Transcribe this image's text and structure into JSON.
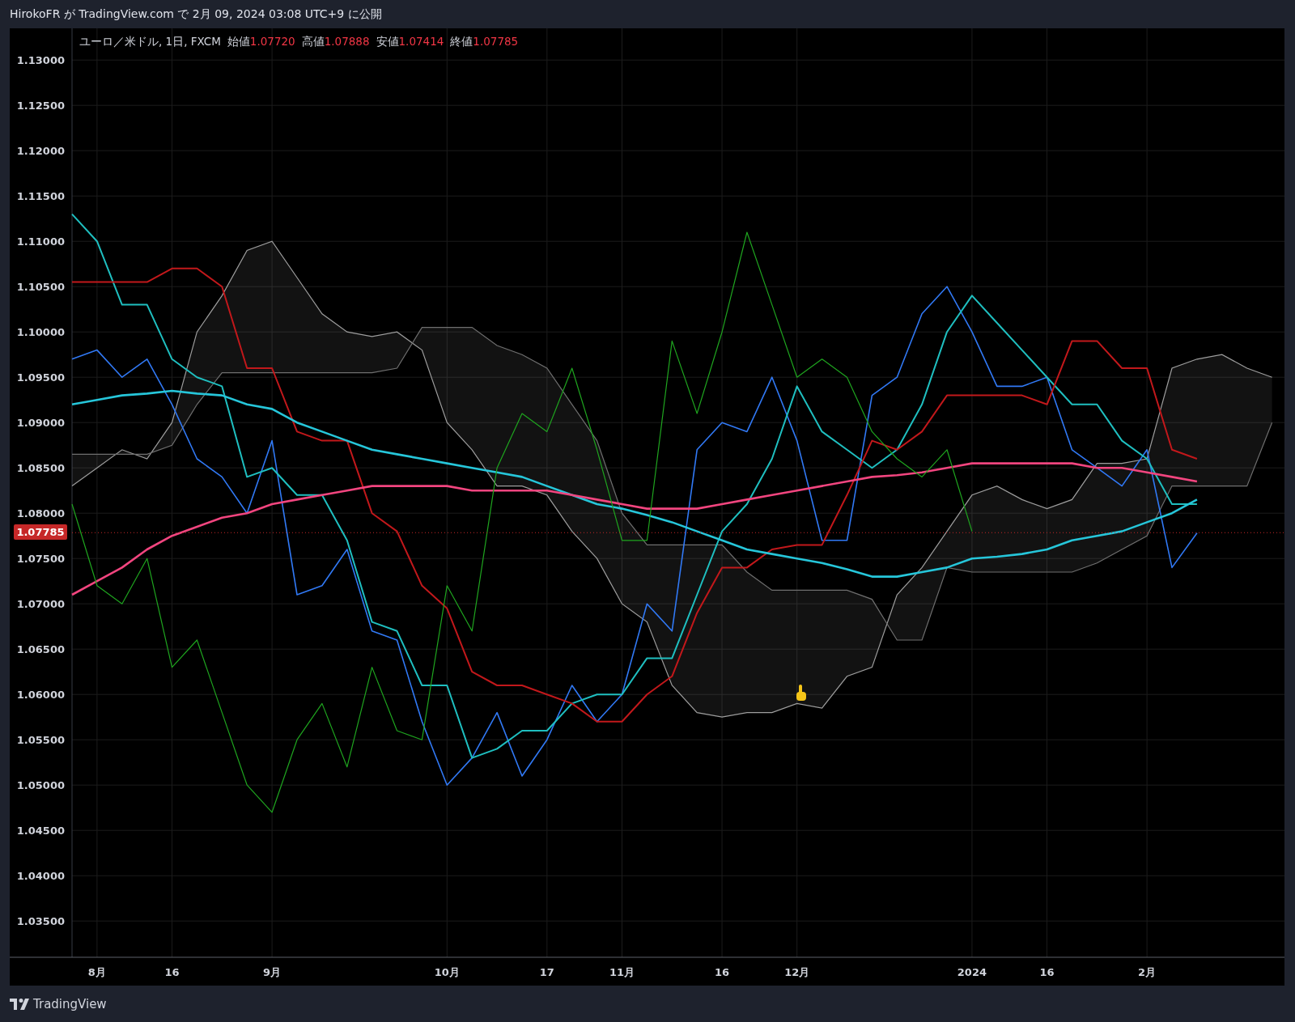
{
  "header": {
    "text": "HirokoFR が TradingView.com で 2月 09, 2024 03:08 UTC+9 に公開"
  },
  "legend": {
    "symbol": "ユーロ／米ドル, 1日, FXCM",
    "fields": [
      {
        "label": "始値",
        "value": "1.07720"
      },
      {
        "label": "高値",
        "value": "1.07888"
      },
      {
        "label": "安値",
        "value": "1.07414"
      },
      {
        "label": "終値",
        "value": "1.07785"
      }
    ]
  },
  "chart": {
    "chart_data": {
      "type": "line",
      "categories": [
        null,
        "8月",
        null,
        null,
        "16",
        null,
        null,
        null,
        "9月",
        null,
        null,
        null,
        null,
        null,
        null,
        "10月",
        null,
        null,
        null,
        "17",
        null,
        null,
        "11月",
        null,
        null,
        null,
        "16",
        null,
        null,
        "12月",
        null,
        null,
        null,
        null,
        null,
        null,
        "2024",
        null,
        null,
        "16",
        null,
        null,
        null,
        "2月",
        null,
        null,
        null,
        null,
        null
      ],
      "ylim": [
        1.031,
        1.1335
      ],
      "grid": true,
      "ref_lines": [
        {
          "axis": "y",
          "value": 1.07785,
          "label": "1.07785",
          "color": "#c62828"
        }
      ],
      "yticks": [
        {
          "value": 1.13,
          "label": "1.13000"
        },
        {
          "value": 1.125,
          "label": "1.12500"
        },
        {
          "value": 1.12,
          "label": "1.12000"
        },
        {
          "value": 1.115,
          "label": "1.11500"
        },
        {
          "value": 1.11,
          "label": "1.11000"
        },
        {
          "value": 1.105,
          "label": "1.10500"
        },
        {
          "value": 1.1,
          "label": "1.10000"
        },
        {
          "value": 1.095,
          "label": "1.09500"
        },
        {
          "value": 1.09,
          "label": "1.09000"
        },
        {
          "value": 1.085,
          "label": "1.08500"
        },
        {
          "value": 1.08,
          "label": "1.08000"
        },
        {
          "value": 1.075,
          "label": "1.07500"
        },
        {
          "value": 1.07,
          "label": "1.07000"
        },
        {
          "value": 1.065,
          "label": "1.06500"
        },
        {
          "value": 1.06,
          "label": "1.06000"
        },
        {
          "value": 1.055,
          "label": "1.05500"
        },
        {
          "value": 1.05,
          "label": "1.05000"
        },
        {
          "value": 1.045,
          "label": "1.04500"
        },
        {
          "value": 1.04,
          "label": "1.04000"
        },
        {
          "value": 1.035,
          "label": "1.03500"
        }
      ],
      "series": [
        {
          "color": "#3179f5",
          "values": [
            1.097,
            1.098,
            1.095,
            1.097,
            1.092,
            1.086,
            1.084,
            1.08,
            1.088,
            1.071,
            1.072,
            1.076,
            1.067,
            1.066,
            1.057,
            1.05,
            1.053,
            1.058,
            1.051,
            1.055,
            1.061,
            1.057,
            1.06,
            1.07,
            1.067,
            1.087,
            1.09,
            1.089,
            1.095,
            1.088,
            1.077,
            1.077,
            1.093,
            1.095,
            1.102,
            1.105,
            1.1,
            1.094,
            1.094,
            1.095,
            1.087,
            1.085,
            1.083,
            1.087,
            1.074,
            1.0778,
            null,
            null,
            null
          ]
        },
        {
          "color": "#1fbfc0",
          "values": [
            1.113,
            1.11,
            1.103,
            1.103,
            1.097,
            1.095,
            1.094,
            1.084,
            1.085,
            1.082,
            1.082,
            1.077,
            1.068,
            1.067,
            1.061,
            1.061,
            1.053,
            1.054,
            1.056,
            1.056,
            1.059,
            1.06,
            1.06,
            1.064,
            1.064,
            1.071,
            1.078,
            1.081,
            1.086,
            1.094,
            1.089,
            1.087,
            1.085,
            1.087,
            1.092,
            1.1,
            1.104,
            1.101,
            1.098,
            1.095,
            1.092,
            1.092,
            1.088,
            1.086,
            1.081,
            1.081,
            null,
            null,
            null
          ]
        },
        {
          "color": "#c2181b",
          "values": [
            1.1055,
            1.1055,
            1.1055,
            1.1055,
            1.107,
            1.107,
            1.105,
            1.096,
            1.096,
            1.089,
            1.088,
            1.088,
            1.08,
            1.078,
            1.072,
            1.0695,
            1.0625,
            1.061,
            1.061,
            1.06,
            1.059,
            1.057,
            1.057,
            1.06,
            1.062,
            1.069,
            1.074,
            1.074,
            1.076,
            1.0765,
            1.0765,
            1.082,
            1.088,
            1.087,
            1.089,
            1.093,
            1.093,
            1.093,
            1.093,
            1.092,
            1.099,
            1.099,
            1.096,
            1.096,
            1.087,
            1.086,
            null,
            null,
            null
          ]
        },
        {
          "color": "#26c6da",
          "values": [
            1.092,
            1.0925,
            1.093,
            1.0932,
            1.0935,
            1.0932,
            1.093,
            1.092,
            1.0915,
            1.09,
            1.089,
            1.088,
            1.087,
            1.0865,
            1.086,
            1.0855,
            1.085,
            1.0845,
            1.084,
            1.083,
            1.082,
            1.081,
            1.0805,
            1.0798,
            1.079,
            1.078,
            1.077,
            1.076,
            1.0755,
            1.075,
            1.0745,
            1.0738,
            1.073,
            1.073,
            1.0735,
            1.074,
            1.075,
            1.0752,
            1.0755,
            1.076,
            1.077,
            1.0775,
            1.078,
            1.079,
            1.08,
            1.0815,
            null,
            null,
            null
          ]
        },
        {
          "color": "#f2457f",
          "values": [
            1.071,
            1.0725,
            1.074,
            1.076,
            1.0775,
            1.0785,
            1.0795,
            1.08,
            1.081,
            1.0815,
            1.082,
            1.0825,
            1.083,
            1.083,
            1.083,
            1.083,
            1.0825,
            1.0825,
            1.0825,
            1.0825,
            1.082,
            1.0815,
            1.081,
            1.0805,
            1.0805,
            1.0805,
            1.081,
            1.0815,
            1.082,
            1.0825,
            1.083,
            1.0835,
            1.084,
            1.0842,
            1.0845,
            1.085,
            1.0855,
            1.0855,
            1.0855,
            1.0855,
            1.0855,
            1.085,
            1.085,
            1.0845,
            1.084,
            1.0835,
            null,
            null,
            null
          ]
        },
        {
          "color": "#1fa51f",
          "values": [
            1.081,
            1.072,
            1.07,
            1.075,
            1.063,
            1.066,
            1.058,
            1.05,
            1.047,
            1.055,
            1.059,
            1.052,
            1.063,
            1.056,
            1.055,
            1.072,
            1.067,
            1.085,
            1.091,
            1.089,
            1.096,
            1.087,
            1.077,
            1.077,
            1.099,
            1.091,
            1.1,
            1.111,
            1.103,
            1.095,
            1.097,
            1.095,
            1.089,
            1.086,
            1.084,
            1.087,
            1.078,
            null,
            null,
            null,
            null,
            null,
            null,
            null,
            null,
            null,
            null,
            null,
            null
          ]
        },
        {
          "color": "#9e9e9e",
          "values": [
            1.083,
            1.085,
            1.087,
            1.086,
            1.09,
            1.1,
            1.104,
            1.109,
            1.11,
            1.106,
            1.102,
            1.1,
            1.0995,
            1.1,
            1.098,
            1.09,
            1.087,
            1.083,
            1.083,
            1.082,
            1.078,
            1.075,
            1.07,
            1.068,
            1.061,
            1.058,
            1.0575,
            1.058,
            1.058,
            1.059,
            1.0585,
            1.062,
            1.063,
            1.071,
            1.074,
            1.078,
            1.082,
            1.083,
            1.0815,
            1.0805,
            1.0815,
            1.0855,
            1.0855,
            1.086,
            1.096,
            1.097,
            1.0975,
            1.096,
            1.095
          ]
        },
        {
          "color": "#6f6f6f",
          "values": [
            1.0865,
            1.0865,
            1.0865,
            1.0865,
            1.0875,
            1.092,
            1.0955,
            1.0955,
            1.0955,
            1.0955,
            1.0955,
            1.0955,
            1.0955,
            1.096,
            1.1005,
            1.1005,
            1.1005,
            1.0985,
            1.0975,
            1.096,
            1.092,
            1.088,
            1.08,
            1.0765,
            1.0765,
            1.0765,
            1.0765,
            1.0735,
            1.0715,
            1.0715,
            1.0715,
            1.0715,
            1.0705,
            1.066,
            1.066,
            1.074,
            1.0735,
            1.0735,
            1.0735,
            1.0735,
            1.0735,
            1.0745,
            1.076,
            1.0775,
            1.083,
            1.083,
            1.083,
            1.083,
            1.09
          ]
        }
      ]
    }
  },
  "footer": {
    "brand": "TradingView"
  }
}
